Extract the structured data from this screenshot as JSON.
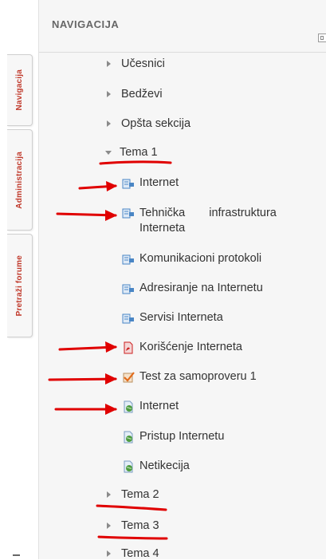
{
  "dock": {
    "tabs": [
      {
        "label": "Navigacija"
      },
      {
        "label": "Administracija"
      },
      {
        "label": "Pretraži forume"
      }
    ]
  },
  "panel": {
    "title": "NAVIGACIJA"
  },
  "tree": {
    "items": [
      {
        "label": "Učesnici",
        "type": "branch",
        "expanded": false
      },
      {
        "label": "Bedževi",
        "type": "branch",
        "expanded": false
      },
      {
        "label": "Opšta sekcija",
        "type": "branch",
        "expanded": false
      },
      {
        "label": "Tema 1",
        "type": "branch",
        "expanded": true,
        "children": [
          {
            "label": "Internet",
            "icon": "page-icon"
          },
          {
            "label_part1": "Tehnička",
            "label_part2": "infrastruktura",
            "label_part3": "Interneta",
            "icon": "page-icon"
          },
          {
            "label": "Komunikacioni protokoli",
            "icon": "page-icon"
          },
          {
            "label": "Adresiranje na Internetu",
            "icon": "page-icon"
          },
          {
            "label": "Servisi Interneta",
            "icon": "page-icon"
          },
          {
            "label": "Korišćenje Interneta",
            "icon": "pdf-icon"
          },
          {
            "label": "Test za samoproveru 1",
            "icon": "quiz-icon"
          },
          {
            "label": "Internet",
            "icon": "url-icon"
          },
          {
            "label": "Pristup Internetu",
            "icon": "url-icon"
          },
          {
            "label": "Netikecija",
            "icon": "url-icon"
          }
        ]
      },
      {
        "label": "Tema 2",
        "type": "branch",
        "expanded": false
      },
      {
        "label": "Tema 3",
        "type": "branch",
        "expanded": false
      },
      {
        "label": "Tema 4",
        "type": "branch",
        "expanded": false
      }
    ]
  },
  "colors": {
    "annotation": "#e00000",
    "dock_text": "#c0392b",
    "page_icon": "#4a86c5",
    "pdf_icon": "#cc1f1f",
    "quiz_icon": "#e26a1a",
    "url_icon": "#4d9c3f"
  }
}
